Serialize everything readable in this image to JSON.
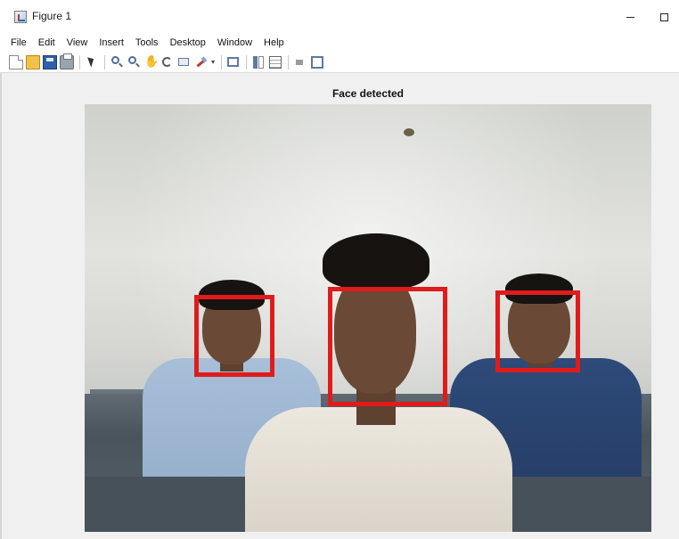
{
  "window": {
    "title": "Figure 1",
    "icon": "matlab-figure-icon",
    "controls": [
      "minimize",
      "maximize"
    ]
  },
  "menubar": {
    "items": [
      "File",
      "Edit",
      "View",
      "Insert",
      "Tools",
      "Desktop",
      "Window",
      "Help"
    ]
  },
  "toolbar": {
    "buttons": [
      "new-figure-icon",
      "open-file-icon",
      "save-figure-icon",
      "print-figure-icon",
      "edit-plot-icon",
      "zoom-in-icon",
      "zoom-out-icon",
      "pan-icon",
      "rotate-3d-icon",
      "data-cursor-icon",
      "brush-icon",
      "link-plot-icon",
      "insert-colorbar-icon",
      "insert-legend-icon",
      "hide-plot-tools-icon",
      "show-plot-tools-icon"
    ]
  },
  "axes": {
    "title": "Face detected"
  },
  "image": {
    "description_visible": "webcam photo of three people seated at benches",
    "detections": [
      {
        "label": "face",
        "color": "#e01b1b"
      },
      {
        "label": "face",
        "color": "#e01b1b"
      },
      {
        "label": "face",
        "color": "#e01b1b"
      }
    ]
  }
}
